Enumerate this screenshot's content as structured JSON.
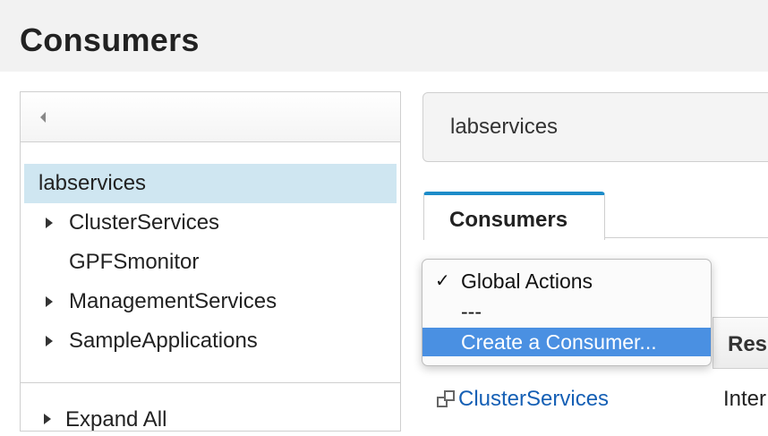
{
  "page": {
    "title": "Consumers"
  },
  "tree": {
    "items": [
      {
        "label": "labservices"
      },
      {
        "label": "ClusterServices"
      },
      {
        "label": "GPFSmonitor"
      },
      {
        "label": "ManagementServices"
      },
      {
        "label": "SampleApplications"
      }
    ],
    "expand_all": "Expand All"
  },
  "path": {
    "text": "labservices"
  },
  "tabs": [
    {
      "label": "Consumers"
    }
  ],
  "menu": {
    "items": [
      {
        "label": "Global Actions",
        "checked": true
      },
      {
        "label": "---"
      },
      {
        "label": "Create a Consumer...",
        "highlighted": true
      }
    ]
  },
  "table": {
    "header_partial": "Res",
    "rows": [
      {
        "name": "ClusterServices",
        "type_partial": "Inter"
      }
    ]
  },
  "colors": {
    "selected_row": "#cfe6f1",
    "tab_accent": "#1d8cc9",
    "link": "#1660b5",
    "menu_highlight": "#4a90e2"
  },
  "icons": {
    "collapse": "triangle-left-icon",
    "tree_expand": "triangle-right-icon",
    "consumer": "consumer-group-icon",
    "check": "checkmark-icon"
  }
}
